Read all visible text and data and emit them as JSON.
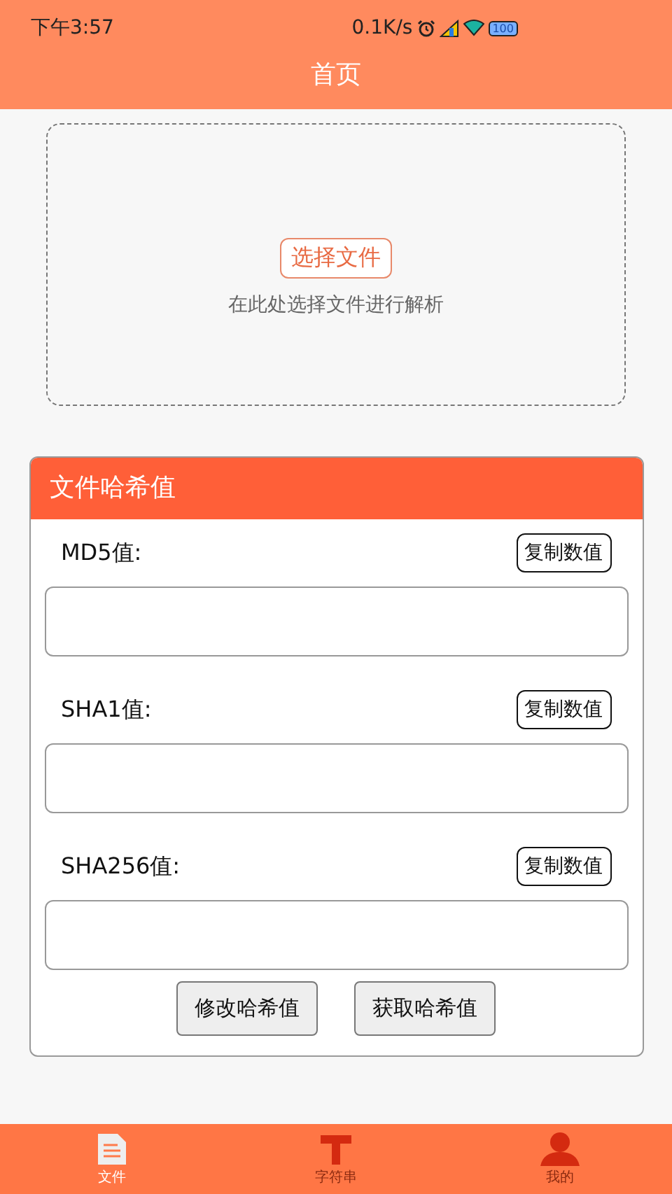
{
  "status_bar": {
    "time": "下午3:57",
    "speed": "0.1K/s",
    "battery": "100"
  },
  "title": "首页",
  "upload": {
    "button": "选择文件",
    "hint": "在此处选择文件进行解析"
  },
  "hash_card": {
    "title": "文件哈希值",
    "hashes": [
      {
        "label": "MD5值:",
        "copy_button": "复制数值"
      },
      {
        "label": "SHA1值:",
        "copy_button": "复制数值"
      },
      {
        "label": "SHA256值:",
        "copy_button": "复制数值"
      }
    ],
    "actions": [
      "修改哈希值",
      "获取哈希值"
    ]
  },
  "bottom_nav": [
    {
      "label": "文件",
      "kind": "file",
      "selected": true
    },
    {
      "label": "字符串",
      "kind": "text",
      "selected": false
    },
    {
      "label": "我的",
      "kind": "person",
      "selected": false
    }
  ]
}
